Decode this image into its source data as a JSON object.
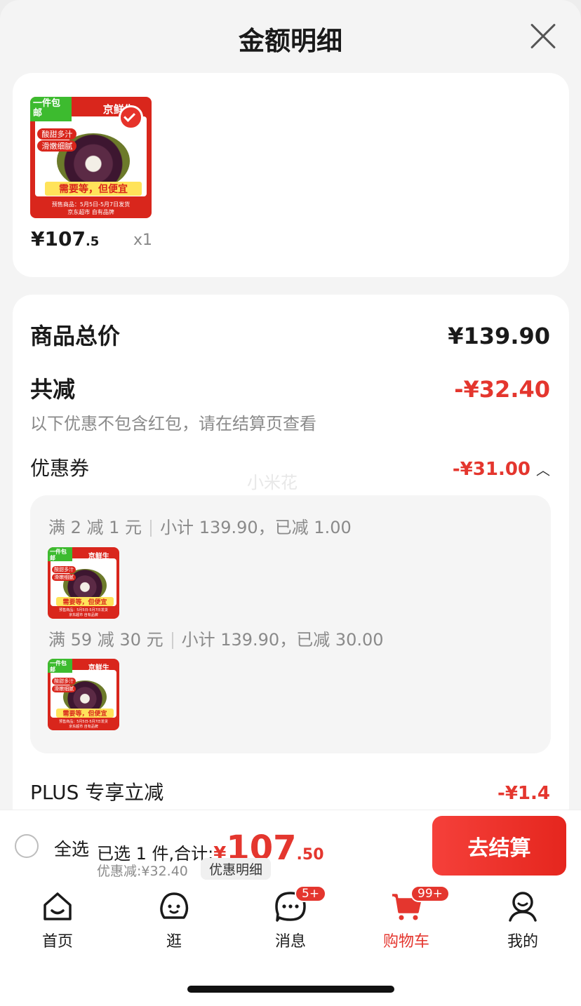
{
  "sheet": {
    "title": "金额明细"
  },
  "product": {
    "thumb": {
      "corner": "一件包邮",
      "brand": "京鲜生",
      "tags": [
        "酸甜多汁",
        "滑嫩细腻"
      ],
      "slogan": "需要等，但便宜",
      "footer": "预售商品：5月5日-5月7日发货",
      "footer2": "京东超市 自有品牌"
    },
    "price_int": "¥107",
    "price_dec": ".5",
    "qty": "x1"
  },
  "detail": {
    "total_label": "商品总价",
    "total_value": "¥139.90",
    "reduce_label": "共减",
    "reduce_value": "-¥32.40",
    "note": "以下优惠不包含红包，请在结算页查看",
    "coupon_label": "优惠券",
    "coupon_value": "-¥31.00",
    "watermark": "小米花",
    "coupons": [
      {
        "rule": "满 2 减 1 元",
        "detail": "小计 139.90，已减 1.00"
      },
      {
        "rule": "满 59 减 30 元",
        "detail": "小计 139.90，已减 30.00"
      }
    ],
    "plus_label": "PLUS 专享立减",
    "plus_value": "-¥1.4"
  },
  "checkout": {
    "select_all": "全选",
    "selected_text": "已选 1 件,合计:",
    "yen": "¥",
    "total_int": "107",
    "total_dec": ".50",
    "discount_text": "优惠减:¥32.40",
    "detail_chip": "优惠明细",
    "button": "去结算"
  },
  "tabs": [
    {
      "label": "首页",
      "icon": "home-icon"
    },
    {
      "label": "逛",
      "icon": "face-icon"
    },
    {
      "label": "消息",
      "icon": "message-icon",
      "badge": "5+"
    },
    {
      "label": "购物车",
      "icon": "cart-icon",
      "badge": "99+"
    },
    {
      "label": "我的",
      "icon": "profile-icon"
    }
  ],
  "colors": {
    "accent": "#e4362e",
    "green": "#3dbb2f"
  }
}
